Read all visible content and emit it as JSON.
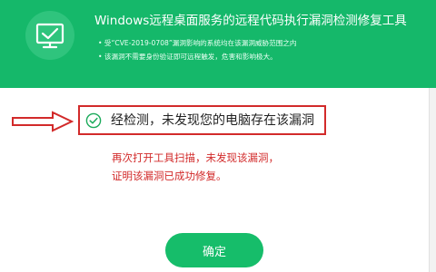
{
  "header": {
    "title": "Windows远程桌面服务的远程代码执行漏洞检测修复工具",
    "bullets": [
      "受“CVE-2019-0708”漏洞影响的系统均在该漏洞威胁范围之内",
      "该漏洞不需要身份验证即可远程触发，危害和影响极大。"
    ],
    "icon": "monitor-check-icon"
  },
  "result": {
    "text": "经检测，未发现您的电脑存在该漏洞",
    "icon": "check-circle-icon"
  },
  "annotation": {
    "lines": [
      "再次打开工具扫描，未发现该漏洞，",
      "证明该漏洞已成功修复。"
    ]
  },
  "actions": {
    "ok_label": "确定"
  },
  "colors": {
    "brand_green": "#15b86a",
    "annotation_red": "#d22a2a",
    "check_green": "#1aaa5a"
  }
}
